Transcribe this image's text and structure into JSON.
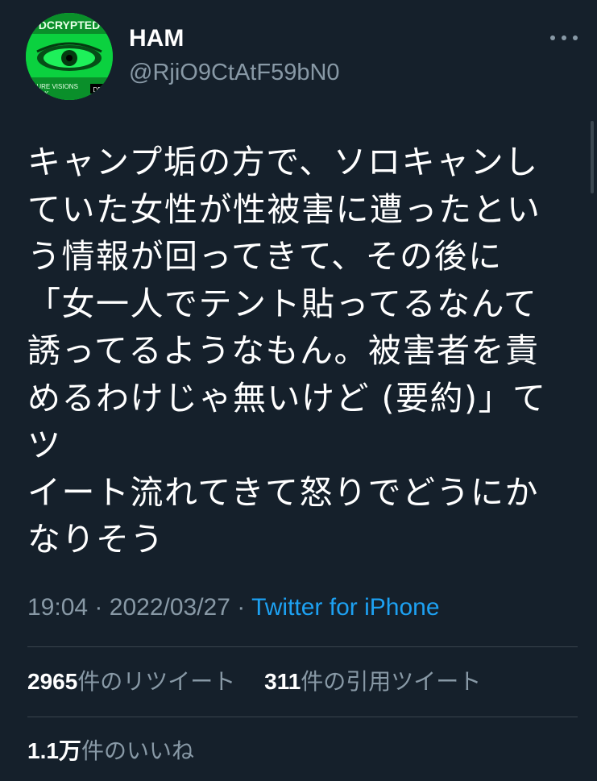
{
  "tweet": {
    "author": {
      "display_name": "HAM",
      "handle": "@RjiO9CtAtF59bN0",
      "avatar_text_top": "DCRYPTED",
      "avatar_text_bottom": "PURE VISIONS",
      "avatar_text_bottom2": "LEAK",
      "avatar_badge": "DB"
    },
    "more_icon": "more-horizontal-icon",
    "text": "キャンプ垢の方で、ソロキャンし\nていた女性が性被害に遭ったとい\nう情報が回ってきて、その後に\n「女一人でテント貼ってるなんて\n誘ってるようなもん。被害者を責\nめるわけじゃ無いけど (要約)」てツ\nイート流れてきて怒りでどうにか\nなりそう",
    "time": "19:04",
    "separator": "·",
    "date": "2022/03/27",
    "source": "Twitter for iPhone",
    "stats": {
      "retweets_count": "2965",
      "retweets_label": "件のリツイート",
      "quotes_count": "311",
      "quotes_label": "件の引用ツイート",
      "likes_count": "1.1万",
      "likes_label": "件のいいね"
    }
  },
  "colors": {
    "background": "#15202b",
    "text_primary": "#ffffff",
    "text_secondary": "#8899a6",
    "link": "#1da1f2",
    "divider": "#38444d",
    "avatar_green": "#08c93c"
  }
}
